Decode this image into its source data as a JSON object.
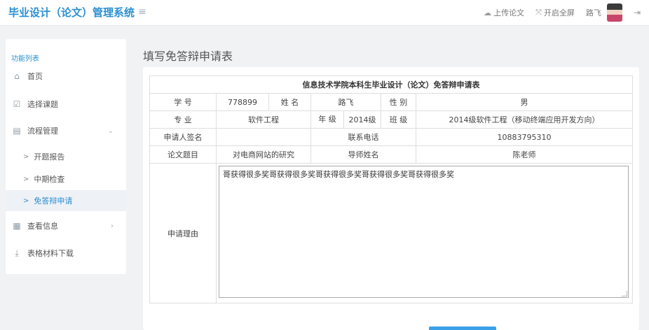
{
  "app": {
    "title": "毕业设计（论文）管理系统"
  },
  "topbar": {
    "upload_label": "上传论文",
    "fullscreen_label": "开启全屏",
    "user_name": "路飞"
  },
  "sidebar": {
    "heading": "功能列表",
    "items": [
      {
        "label": "首页"
      },
      {
        "label": "选择课题"
      },
      {
        "label": "流程管理"
      },
      {
        "label": "开题报告"
      },
      {
        "label": "中期检查"
      },
      {
        "label": "免答辩申请"
      },
      {
        "label": "查看信息"
      },
      {
        "label": "表格材料下载"
      }
    ]
  },
  "page": {
    "title": "填写免答辩申请表"
  },
  "form": {
    "title": "信息技术学院本科生毕业设计（论文）免答辩申请表",
    "labels": {
      "student_id": "学 号",
      "name": "姓 名",
      "gender": "性 别",
      "major": "专 业",
      "grade": "年 级",
      "class": "班 级",
      "applicant_sign": "申请人签名",
      "phone": "联系电话",
      "thesis_title": "论文题目",
      "advisor": "导师姓名",
      "reason": "申请理由"
    },
    "values": {
      "student_id": "778899",
      "name": "路飞",
      "gender": "男",
      "major": "软件工程",
      "grade": "2014级",
      "class": "2014级软件工程（移动终端应用开发方向）",
      "applicant_sign": "",
      "phone": "10883795310",
      "thesis_title": "对电商网站的研究",
      "advisor": "陈老师",
      "reason": "哥获得很多奖哥获得很多奖哥获得很多奖哥获得很多奖哥获得很多奖"
    }
  },
  "colors": {
    "accent": "#2a8fd1",
    "button": "#3aa0e8"
  },
  "icons": [
    "menu-icon",
    "cloud-upload-icon",
    "fullscreen-icon",
    "avatar",
    "logout-icon",
    "home-icon",
    "checkbox-icon",
    "flow-icon",
    "chevron-down-icon",
    "chevron-right-icon",
    "file-icon",
    "download-icon"
  ]
}
